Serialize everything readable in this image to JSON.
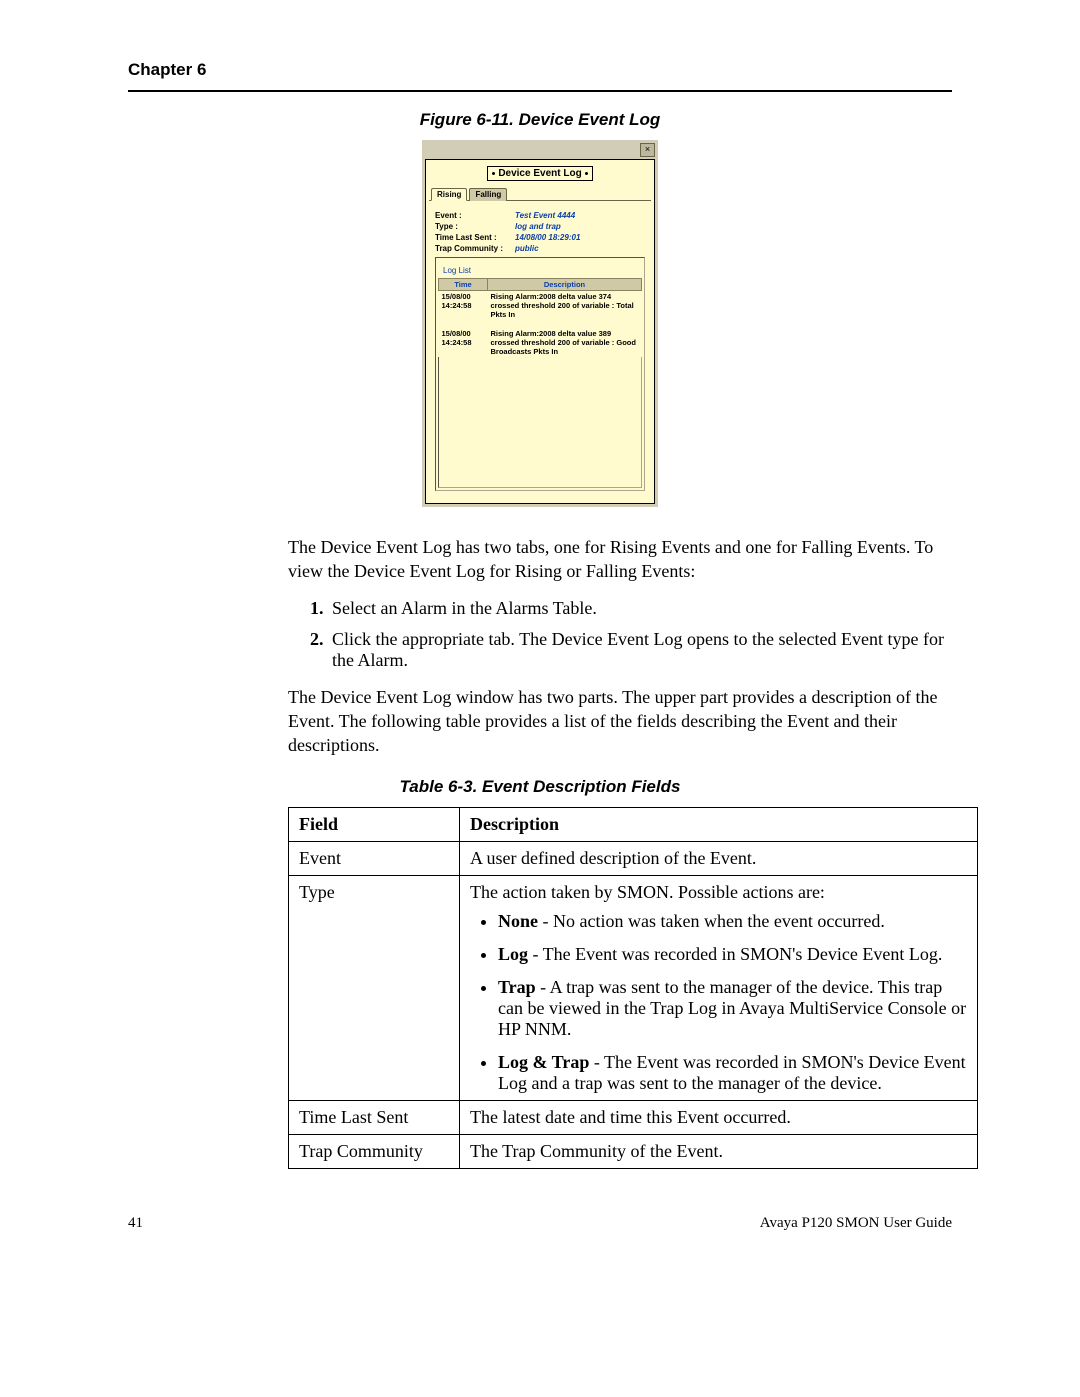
{
  "header": {
    "label": "Chapter 6"
  },
  "figure": {
    "caption": "Figure 6-11.  Device Event Log",
    "dialog": {
      "close": "×",
      "banner": "Device Event Log",
      "tabs": {
        "rising": "Rising",
        "falling": "Falling"
      },
      "fields": {
        "event_k": "Event :",
        "event_v": "Test Event 4444",
        "type_k": "Type :",
        "type_v": "log and trap",
        "last_k": "Time Last Sent :",
        "last_v": "14/08/00 18:29:01",
        "trap_k": "Trap Community :",
        "trap_v": "public"
      },
      "loglist_label": "Log List",
      "th_time": "Time",
      "th_desc": "Description",
      "rows": [
        {
          "t1": "15/08/00",
          "t2": "14:24:58",
          "d": "Rising Alarm:2008 delta value 374 crossed threshold 200 of variable : Total Pkts In"
        },
        {
          "t1": "15/08/00",
          "t2": "14:24:58",
          "d": "Rising Alarm:2008 delta value 389 crossed threshold 200 of variable : Good Broadcasts Pkts In"
        }
      ]
    }
  },
  "body": {
    "p1": "The Device Event Log has two tabs, one for Rising Events and one for Falling Events. To view the Device Event Log for Rising or Falling Events:",
    "s1": "Select an Alarm in the Alarms Table.",
    "s2": "Click the appropriate tab. The Device Event Log opens to the selected Event type for the Alarm.",
    "p2": "The Device Event Log window has two parts. The upper part provides a description of the Event. The following table provides a list of the fields describing the Event and their descriptions."
  },
  "table63": {
    "caption": "Table 6-3.  Event Description Fields",
    "headers": {
      "field": "Field",
      "desc": "Description"
    },
    "rows": {
      "event": {
        "f": "Event",
        "d": "A user defined description of the Event."
      },
      "type": {
        "f": "Type",
        "intro": "The action taken by SMON. Possible actions are:",
        "items": [
          {
            "b": "None",
            "t": " - No action was taken when the event occurred."
          },
          {
            "b": "Log",
            "t": " - The Event was recorded in SMON's Device Event Log."
          },
          {
            "b": "Trap",
            "t": " - A trap was sent to the manager of the device. This trap can be viewed in the Trap Log in Avaya MultiService Console or HP NNM."
          },
          {
            "b": "Log & Trap",
            "t": " - The Event was recorded in SMON's Device Event Log and a trap was sent to the manager of the device."
          }
        ]
      },
      "last": {
        "f": "Time Last Sent",
        "d": "The latest date and time this Event occurred."
      },
      "trap": {
        "f": "Trap Community",
        "d": "The Trap Community of the Event."
      }
    }
  },
  "footer": {
    "page": "41",
    "guide": "Avaya P120 SMON User Guide"
  }
}
